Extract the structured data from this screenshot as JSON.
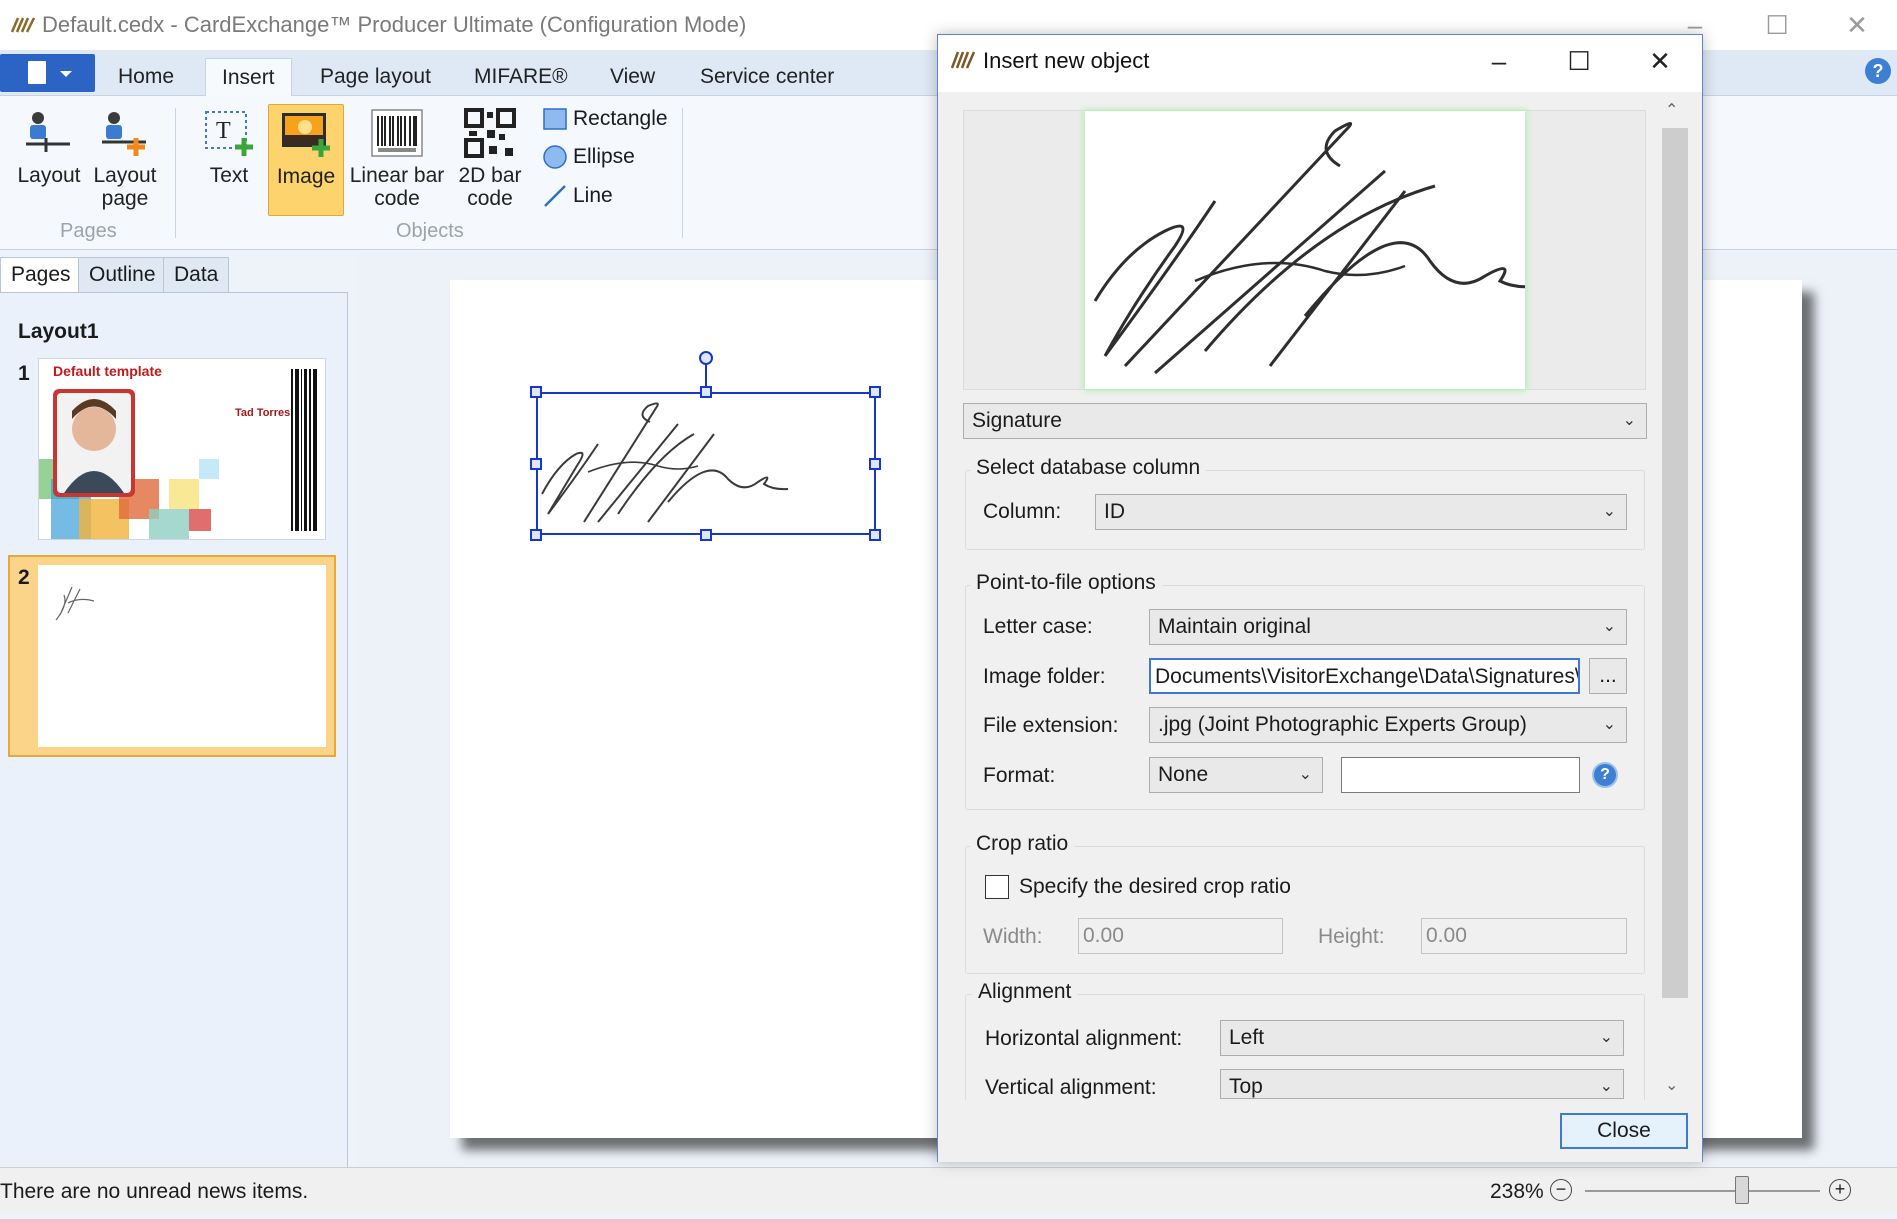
{
  "window": {
    "title": "Default.cedx - CardExchange™ Producer Ultimate (Configuration Mode)",
    "minimize_glyph": "–",
    "maximize_glyph": "☐",
    "close_glyph": "✕"
  },
  "ribbon": {
    "tabs": [
      {
        "label": "Home"
      },
      {
        "label": "Insert",
        "active": true
      },
      {
        "label": "Page layout"
      },
      {
        "label": "MIFARE®"
      },
      {
        "label": "View"
      },
      {
        "label": "Service center"
      }
    ],
    "help_glyph": "?",
    "pages_group": {
      "label": "Pages",
      "buttons": [
        {
          "label_line1": "Layout",
          "label_line2": "",
          "icon": "layout-icon"
        },
        {
          "label_line1": "Layout",
          "label_line2": "page",
          "icon": "layout-page-icon"
        }
      ]
    },
    "objects_group": {
      "label": "Objects",
      "buttons": [
        {
          "label_line1": "Text",
          "label_line2": "",
          "icon": "text-icon"
        },
        {
          "label_line1": "Image",
          "label_line2": "",
          "icon": "image-icon",
          "selected": true
        },
        {
          "label_line1": "Linear bar",
          "label_line2": "code",
          "icon": "barcode-icon"
        },
        {
          "label_line1": "2D bar",
          "label_line2": "code",
          "icon": "qr-code-icon"
        }
      ],
      "shapes": [
        {
          "label": "Rectangle",
          "icon": "rectangle-icon"
        },
        {
          "label": "Ellipse",
          "icon": "ellipse-icon"
        },
        {
          "label": "Line",
          "icon": "line-icon"
        }
      ]
    }
  },
  "left_pane": {
    "tabs": [
      {
        "label": "Pages",
        "active": true
      },
      {
        "label": "Outline"
      },
      {
        "label": "Data"
      }
    ],
    "layout_name": "Layout1",
    "pages": [
      {
        "number": "1",
        "template_title": "Default template",
        "name_on_card": "Tad Torres"
      },
      {
        "number": "2",
        "selected": true
      }
    ]
  },
  "status_bar": {
    "message": "There are no unread news items.",
    "zoom": "238%",
    "zoom_minus": "−",
    "zoom_plus": "+"
  },
  "dialog": {
    "title": "Insert new object",
    "min_glyph": "–",
    "max_glyph": "☐",
    "close_glyph": "✕",
    "object_type": "Signature",
    "database_column": {
      "legend": "Select database column",
      "column_label": "Column:",
      "column_value": "ID"
    },
    "point_to_file": {
      "legend": "Point-to-file options",
      "letter_case_label": "Letter case:",
      "letter_case_value": "Maintain original",
      "image_folder_label": "Image folder:",
      "image_folder_value": "Documents\\VisitorExchange\\Data\\Signatures\\",
      "browse_label": "...",
      "file_extension_label": "File extension:",
      "file_extension_value": ".jpg (Joint Photographic Experts Group)",
      "format_label": "Format:",
      "format_value": "None",
      "format_text": "",
      "help_glyph": "?"
    },
    "crop_ratio": {
      "legend": "Crop ratio",
      "checkbox_label": "Specify the desired crop ratio",
      "checked": false,
      "width_label": "Width:",
      "width_value": "0.00",
      "height_label": "Height:",
      "height_value": "0.00"
    },
    "alignment": {
      "legend": "Alignment",
      "horizontal_label": "Horizontal alignment:",
      "horizontal_value": "Left",
      "vertical_label": "Vertical alignment:",
      "vertical_value": "Top"
    },
    "close_button": "Close"
  },
  "colors": {
    "accent": "#2b64c4",
    "selected_button": "#fcd36d",
    "selection_box": "#1836c8",
    "preview_glow": "#b7efb7"
  }
}
